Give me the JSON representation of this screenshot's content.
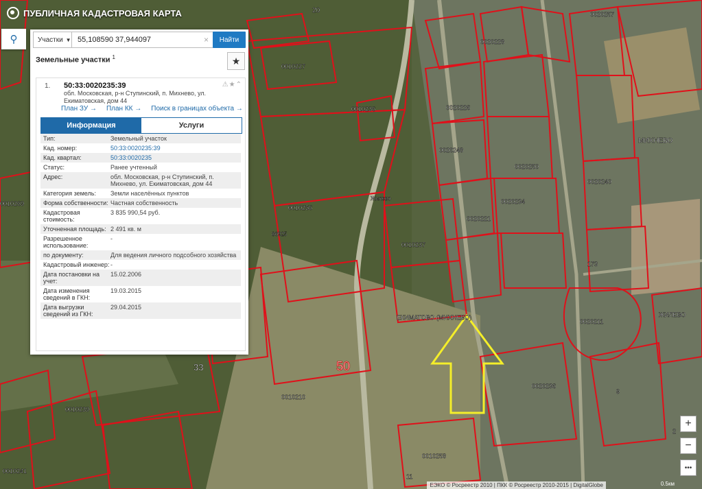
{
  "app": {
    "title": "ПУБЛИЧНАЯ КАДАСТРОВАЯ КАРТА"
  },
  "search": {
    "type_label": "Участки",
    "query": "55,108590 37,944097",
    "find_label": "Найти"
  },
  "results": {
    "title": "Земельные участки",
    "count_sup": "1",
    "item": {
      "index": "1.",
      "cad_number": "50:33:0020235:39",
      "address": "обл. Московская, р-н Ступинский, п. Михнево, ул. Екиматовская, дом 44",
      "links": [
        "План ЗУ →",
        "План КК →",
        "Поиск в границах объекта →"
      ],
      "tabs": [
        "Информация",
        "Услуги"
      ],
      "rows": [
        {
          "k": "Тип:",
          "v": "Земельный участок"
        },
        {
          "k": "Кад. номер:",
          "v": "50:33:0020235:39"
        },
        {
          "k": "Кад. квартал:",
          "v": "50:33:0020235"
        },
        {
          "k": "Статус:",
          "v": "Ранее учтенный"
        },
        {
          "k": "Адрес:",
          "v": "обл. Московская, р-н Ступинский, п. Михнево, ул. Екиматовская, дом 44"
        },
        {
          "k": "Категория земель:",
          "v": "Земли населённых пунктов"
        },
        {
          "k": "Форма собственности:",
          "v": "Частная собственность"
        },
        {
          "k": "Кадастровая стоимость:",
          "v": "3 835 990,54 руб."
        },
        {
          "k": "Уточненная площадь:",
          "v": "2 491 кв. м"
        },
        {
          "k": "Разрешенное использование:",
          "v": "-"
        },
        {
          "k": "по документу:",
          "v": "Для ведения личного подсобного хозяйства"
        },
        {
          "k": "Кадастровый инженер:",
          "v": "-"
        },
        {
          "k": "Дата постановки на учет:",
          "v": "15.02.2006"
        },
        {
          "k": "Дата изменения сведений в ГКН:",
          "v": "19.03.2015"
        },
        {
          "k": "Дата выгрузки сведений из ГКН:",
          "v": "29.04.2015"
        }
      ]
    }
  },
  "map": {
    "labels": [
      {
        "t": "0010227"
      },
      {
        "t": "0010236"
      },
      {
        "t": "0010256"
      },
      {
        "t": "0010237"
      },
      {
        "t": "0010210"
      },
      {
        "t": "0010239"
      },
      {
        "t": "0010258"
      },
      {
        "t": "0020248"
      },
      {
        "t": "0020226"
      },
      {
        "t": "0020250"
      },
      {
        "t": "0020234"
      },
      {
        "t": "0020240"
      },
      {
        "t": "0020236"
      },
      {
        "t": "0020211"
      },
      {
        "t": "0020257"
      },
      {
        "t": "0010269"
      },
      {
        "t": "0010241"
      },
      {
        "t": "МИХНЕВО"
      },
      {
        "t": "ЕКИМАТОВО (МИХНЕВО)"
      },
      {
        "t": "ЖИЛЕВО"
      },
      {
        "t": "86925"
      },
      {
        "t": "Жилево"
      },
      {
        "t": "20"
      },
      {
        "t": "50"
      },
      {
        "t": "33"
      },
      {
        "t": "173"
      },
      {
        "t": "11"
      },
      {
        "t": "9"
      },
      {
        "t": "2"
      },
      {
        "t": "0020221"
      },
      {
        "t": "0020228"
      }
    ],
    "colors": {
      "boundary": "#e0101a",
      "arrow": "#f4ee2a"
    }
  },
  "controls": {
    "zoom_in": "+",
    "zoom_out": "−",
    "more": "•••"
  },
  "footer": {
    "attribution": "ЕЭКО © Росреестр 2010 | ПКК © Росреестр 2010-2015 | DigitalGlobe",
    "scale": "0.5км"
  }
}
